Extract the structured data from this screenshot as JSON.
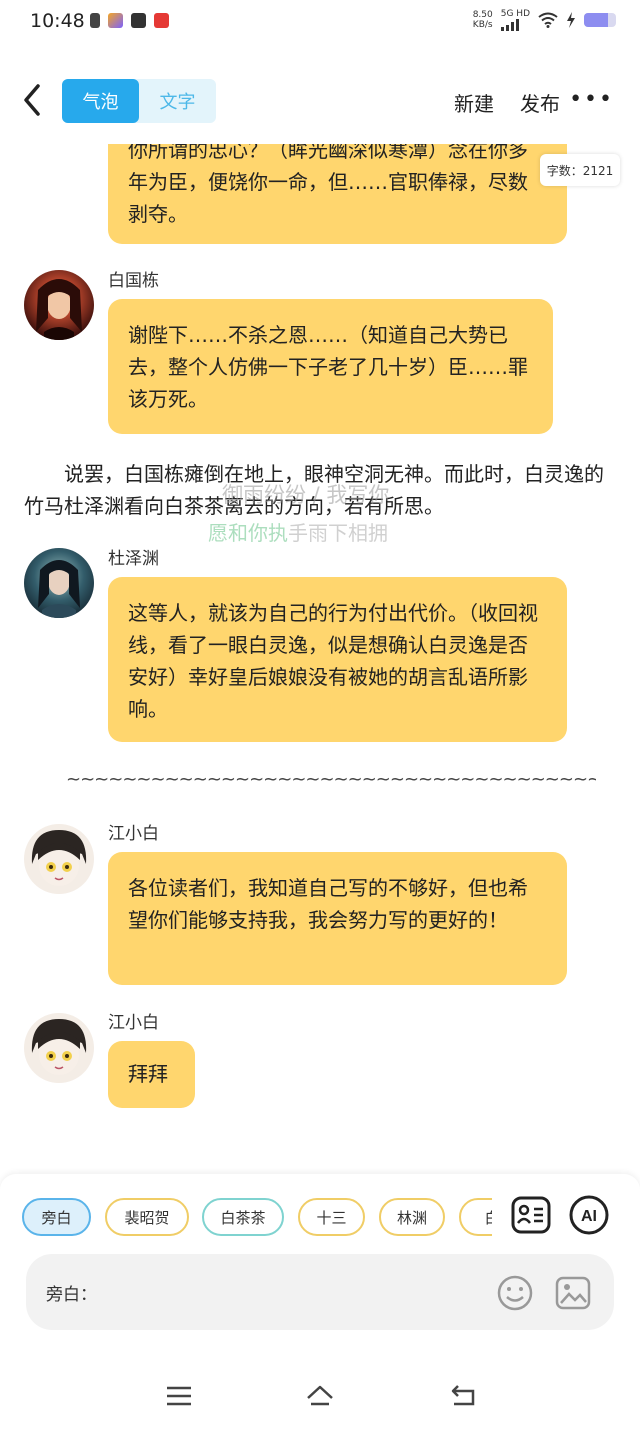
{
  "status": {
    "time": "10:48",
    "net_speed_value": "8.50",
    "net_speed_unit": "KB/s",
    "network": "5G HD",
    "battery_level": 0.75
  },
  "header": {
    "tab_bubble": "气泡",
    "tab_text": "文字",
    "new_label": "新建",
    "publish_label": "发布",
    "more_label": "•••"
  },
  "word_count": "字数：2121",
  "messages": [
    {
      "speaker": "",
      "text": "你所谓的忠心？（眸光幽深似寒潭）念在你多年为臣，便饶你一命，但……官职俸禄，尽数剥夺。"
    },
    {
      "speaker": "白国栋",
      "text": "谢陛下……不杀之恩……（知道自己大势已去，整个人仿佛一下子老了几十岁）臣……罪该万死。"
    },
    {
      "speaker": "",
      "narration": "说罢，白国栋瘫倒在地上，眼神空洞无神。而此时，白灵逸的竹马杜泽渊看向白茶茶离去的方向，若有所思。"
    },
    {
      "speaker": "杜泽渊",
      "text": "这等人，就该为自己的行为付出代价。（收回视线，看了一眼白灵逸，似是想确认白灵逸是否安好）幸好皇后娘娘没有被她的胡言乱语所影响。"
    },
    {
      "divider": "~~~~~~~~~~~~~~~~~~~~~~~~~~~~~~~~~~~~~~~~"
    },
    {
      "speaker": "江小白",
      "text": "各位读者们，我知道自己写的不够好，但也希望你们能够支持我，我会努力写的更好的！"
    },
    {
      "speaker": "江小白",
      "text": "拜拜"
    }
  ],
  "watermark": {
    "line1": "御雨纷纷 / 我写你",
    "line2_a": "愿和你执",
    "line2_b": "手雨下相拥"
  },
  "roles": [
    "旁白",
    "裴昭贺",
    "白茶茶",
    "十三",
    "林渊",
    "白"
  ],
  "input": {
    "label": "旁白："
  },
  "colors": {
    "accent": "#27a9ec",
    "bubble": "#ffd66e"
  }
}
